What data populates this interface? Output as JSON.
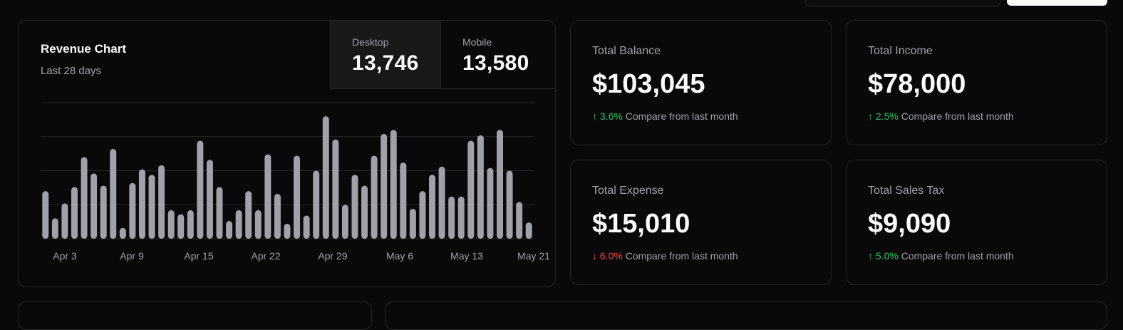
{
  "revenue_chart": {
    "title": "Revenue Chart",
    "subtitle": "Last 28 days",
    "tabs": [
      {
        "label": "Desktop",
        "value": "13,746",
        "active": true
      },
      {
        "label": "Mobile",
        "value": "13,580",
        "active": false
      }
    ]
  },
  "chart_data": {
    "type": "bar",
    "title": "Revenue Chart",
    "subtitle": "Last 28 days",
    "series": [
      {
        "values": [
          35,
          15,
          26,
          38,
          60,
          48,
          39,
          66,
          8,
          41,
          51,
          47,
          54,
          21,
          18,
          21,
          72,
          58,
          38,
          13,
          21,
          35,
          21,
          62,
          33,
          11,
          61,
          17,
          50,
          90,
          73,
          25,
          47,
          39,
          61,
          77,
          80,
          56,
          22,
          35,
          47,
          53,
          31,
          31,
          72,
          76,
          52,
          80,
          50,
          27,
          12
        ]
      }
    ],
    "x_tick_labels": [
      "Apr 3",
      "Apr 9",
      "Apr 15",
      "Apr 22",
      "Apr 29",
      "May 6",
      "May 13",
      "May 21"
    ],
    "ylim": [
      0,
      100
    ],
    "bar_color": "#a1a1aa",
    "grid": true
  },
  "stats": [
    {
      "title": "Total Balance",
      "value": "$103,045",
      "direction": "up",
      "arrow": "↑",
      "change": "3.6%",
      "compare": "Compare from last month"
    },
    {
      "title": "Total Income",
      "value": "$78,000",
      "direction": "up",
      "arrow": "↑",
      "change": "2.5%",
      "compare": "Compare from last month"
    },
    {
      "title": "Total Expense",
      "value": "$15,010",
      "direction": "down",
      "arrow": "↓",
      "change": "6.0%",
      "compare": "Compare from last month"
    },
    {
      "title": "Total Sales Tax",
      "value": "$9,090",
      "direction": "up",
      "arrow": "↑",
      "change": "5.0%",
      "compare": "Compare from last month"
    }
  ],
  "colors": {
    "background": "#09090b",
    "border": "#27272a",
    "positive": "#22c55e",
    "negative": "#ef4444",
    "bar": "#a1a1aa"
  }
}
